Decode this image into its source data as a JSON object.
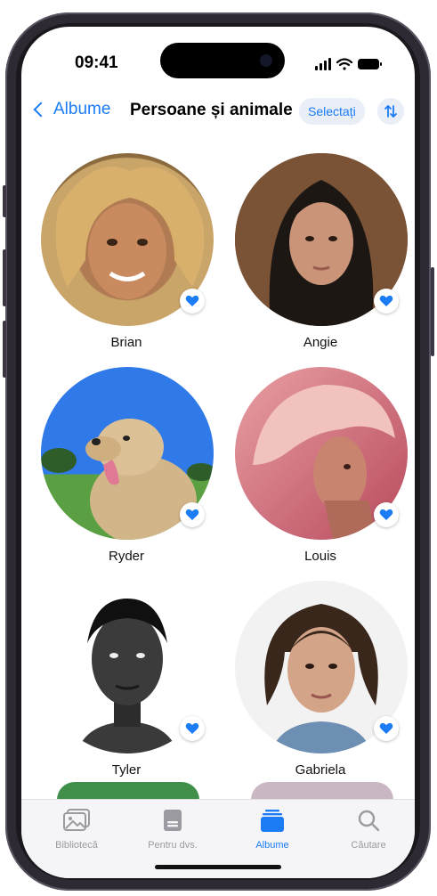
{
  "status_bar": {
    "time": "09:41"
  },
  "nav": {
    "back_label": "Albume",
    "title": "Persoane și animale",
    "select_label": "Selectați",
    "sort_icon": "sort-arrows-icon"
  },
  "people": [
    {
      "name": "Brian",
      "favorite": true
    },
    {
      "name": "Angie",
      "favorite": true
    },
    {
      "name": "Ryder",
      "favorite": true
    },
    {
      "name": "Louis",
      "favorite": true
    },
    {
      "name": "Tyler",
      "favorite": true
    },
    {
      "name": "Gabriela",
      "favorite": true
    }
  ],
  "tabs": [
    {
      "label": "Bibliotecă",
      "icon": "photo-library-icon"
    },
    {
      "label": "Pentru dvs.",
      "icon": "for-you-icon"
    },
    {
      "label": "Albume",
      "icon": "albums-icon",
      "active": true
    },
    {
      "label": "Căutare",
      "icon": "search-icon"
    }
  ],
  "colors": {
    "accent": "#1b7cf5"
  }
}
